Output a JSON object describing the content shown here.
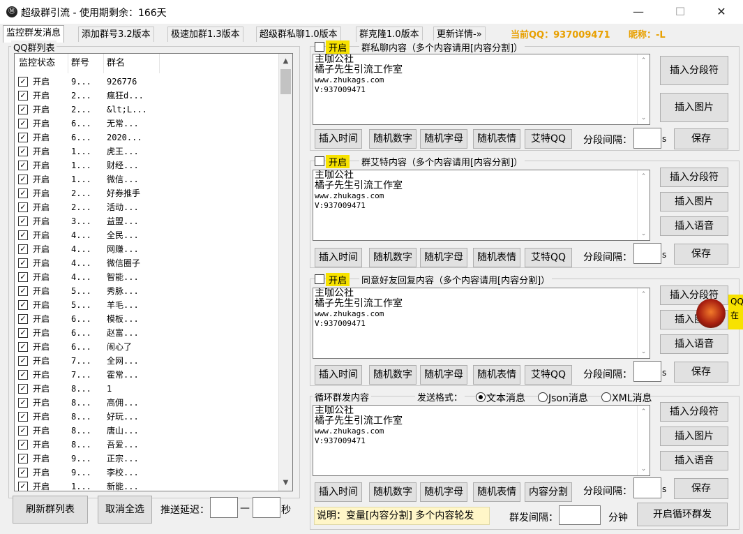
{
  "window": {
    "title": "超级群引流 - 使用期剩余：166天",
    "app_icon": "Ⓜ",
    "minimize": "—",
    "maximize": "☐",
    "close": "✕"
  },
  "tabs": [
    {
      "label": "监控群发消息"
    },
    {
      "label": "添加群号3.2版本"
    },
    {
      "label": "极速加群1.3版本"
    },
    {
      "label": "超级群私聊1.0版本"
    },
    {
      "label": "群克隆1.0版本"
    },
    {
      "label": "更新详情-»"
    }
  ],
  "account": {
    "qq_label": "当前QQ：937009471",
    "nick_label": "昵称：-L"
  },
  "qq_group_list": {
    "title": "QQ群列表",
    "headers": [
      "监控状态",
      "群号",
      "群名"
    ],
    "rows": [
      {
        "status": "开启",
        "id": "9...",
        "name": "926776"
      },
      {
        "status": "开启",
        "id": "2...",
        "name": "瘋狂d..."
      },
      {
        "status": "开启",
        "id": "2...",
        "name": "&lt;L..."
      },
      {
        "status": "开启",
        "id": "6...",
        "name": "无常..."
      },
      {
        "status": "开启",
        "id": "6...",
        "name": "2020..."
      },
      {
        "status": "开启",
        "id": "1...",
        "name": "虎王..."
      },
      {
        "status": "开启",
        "id": "1...",
        "name": "财经..."
      },
      {
        "status": "开启",
        "id": "1...",
        "name": "微信..."
      },
      {
        "status": "开启",
        "id": "2...",
        "name": "好券推手"
      },
      {
        "status": "开启",
        "id": "2...",
        "name": "活动..."
      },
      {
        "status": "开启",
        "id": "3...",
        "name": "益盟..."
      },
      {
        "status": "开启",
        "id": "4...",
        "name": "全民..."
      },
      {
        "status": "开启",
        "id": "4...",
        "name": "网赚..."
      },
      {
        "status": "开启",
        "id": "4...",
        "name": "微信圈子"
      },
      {
        "status": "开启",
        "id": "4...",
        "name": "智能..."
      },
      {
        "status": "开启",
        "id": "5...",
        "name": "秀脉..."
      },
      {
        "status": "开启",
        "id": "5...",
        "name": "羊毛..."
      },
      {
        "status": "开启",
        "id": "6...",
        "name": "模板..."
      },
      {
        "status": "开启",
        "id": "6...",
        "name": "赵富..."
      },
      {
        "status": "开启",
        "id": "6...",
        "name": "闹心了"
      },
      {
        "status": "开启",
        "id": "7...",
        "name": "全网..."
      },
      {
        "status": "开启",
        "id": "7...",
        "name": "霍常..."
      },
      {
        "status": "开启",
        "id": "8...",
        "name": "1"
      },
      {
        "status": "开启",
        "id": "8...",
        "name": "高佣..."
      },
      {
        "status": "开启",
        "id": "8...",
        "name": "好玩..."
      },
      {
        "status": "开启",
        "id": "8...",
        "name": "唐山..."
      },
      {
        "status": "开启",
        "id": "8...",
        "name": "吾爱..."
      },
      {
        "status": "开启",
        "id": "9...",
        "name": "正宗..."
      },
      {
        "status": "开启",
        "id": "9...",
        "name": "李校..."
      },
      {
        "status": "开启",
        "id": "1...",
        "name": "新能..."
      }
    ]
  },
  "bottom_left": {
    "refresh_label": "刷新群列表",
    "deselect_label": "取消全选",
    "delay_label": "推送延迟：",
    "delay_min": "",
    "delay_dash": "—",
    "delay_max": "",
    "delay_unit": "秒"
  },
  "content_lines": [
    "主咖公社",
    "橘子先生引流工作室",
    "www.zhukags.com",
    "V:937009471"
  ],
  "sections": {
    "private": {
      "enable": "开启",
      "title": "群私聊内容（多个内容请用[内容分割]）",
      "side_buttons": [
        "插入分段符",
        "插入图片"
      ],
      "bottom_buttons": [
        "插入时间",
        "随机数字",
        "随机字母",
        "随机表情",
        "艾特QQ"
      ],
      "interval_label": "分段间隔：",
      "interval_unit": "s",
      "save_label": "保存"
    },
    "at": {
      "enable": "开启",
      "title": "群艾特内容（多个内容请用[内容分割]）",
      "side_buttons": [
        "插入分段符",
        "插入图片",
        "插入语音"
      ],
      "bottom_buttons": [
        "插入时间",
        "随机数字",
        "随机字母",
        "随机表情",
        "艾特QQ"
      ],
      "interval_label": "分段间隔：",
      "interval_unit": "s",
      "save_label": "保存"
    },
    "friend": {
      "enable": "开启",
      "title": "同意好友回复内容（多个内容请用[内容分割]）",
      "side_buttons": [
        "插入分段符",
        "插入图片",
        "插入语音"
      ],
      "bottom_buttons": [
        "插入时间",
        "随机数字",
        "随机字母",
        "随机表情",
        "艾特QQ"
      ],
      "interval_label": "分段间隔：",
      "interval_unit": "s",
      "save_label": "保存"
    },
    "loop": {
      "title": "循环群发内容",
      "format_label": "发送格式：",
      "formats": [
        "文本消息",
        "Json消息",
        "XML消息"
      ],
      "format_selected": "文本消息",
      "side_buttons": [
        "插入分段符",
        "插入图片",
        "插入语音"
      ],
      "bottom_buttons": [
        "插入时间",
        "随机数字",
        "随机字母",
        "随机表情",
        "内容分割"
      ],
      "interval_label": "分段间隔：",
      "interval_unit": "s",
      "save_label": "保存",
      "note": "说明：变量[内容分割] 多个内容轮发",
      "group_interval_label": "群发间隔：",
      "group_interval_unit": "分钟",
      "start_label": "开启循环群发"
    }
  },
  "float_widget": {
    "text": "QQ在"
  },
  "colors": {
    "accent_yellow": "#f7e200",
    "qq_orange": "#e8a000"
  }
}
